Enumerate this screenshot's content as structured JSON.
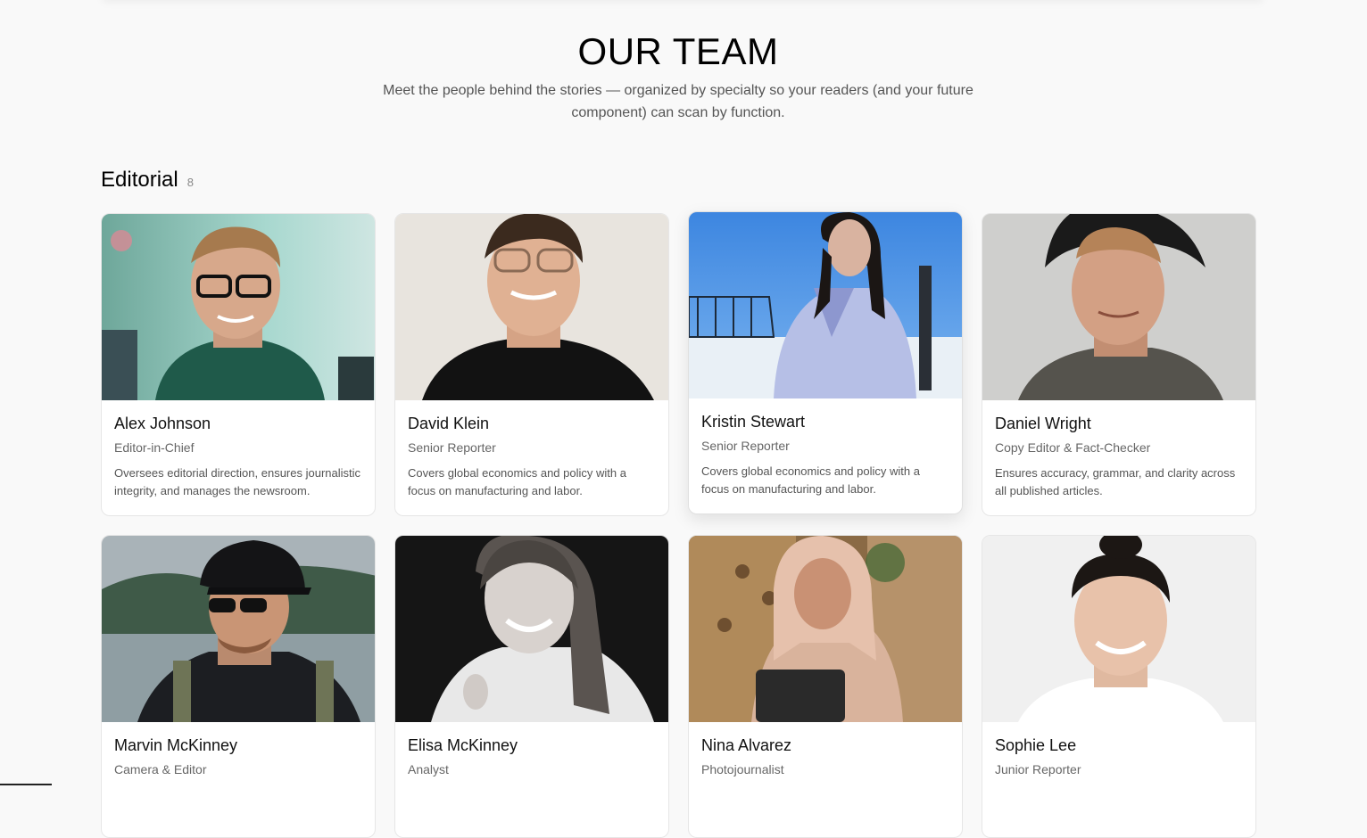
{
  "hero": {
    "title": "OUR TEAM",
    "subtitle": "Meet the people behind the stories — organized by specialty so your readers (and your future component) can scan by function."
  },
  "section": {
    "title": "Editorial",
    "count": "8"
  },
  "members": [
    {
      "name": "Alex Johnson",
      "role": "Editor-in-Chief",
      "desc": "Oversees editorial direction, ensures journalistic integrity, and manages the newsroom."
    },
    {
      "name": "David Klein",
      "role": "Senior Reporter",
      "desc": "Covers global economics and policy with a focus on manufacturing and labor."
    },
    {
      "name": "Kristin Stewart",
      "role": "Senior Reporter",
      "desc": "Covers global economics and policy with a focus on manufacturing and labor."
    },
    {
      "name": "Daniel Wright",
      "role": "Copy Editor & Fact-Checker",
      "desc": "Ensures accuracy, grammar, and clarity across all published articles."
    },
    {
      "name": "Marvin McKinney",
      "role": "Camera & Editor",
      "desc": ""
    },
    {
      "name": "Elisa McKinney",
      "role": "Analyst",
      "desc": ""
    },
    {
      "name": "Nina Alvarez",
      "role": "Photojournalist",
      "desc": ""
    },
    {
      "name": "Sophie Lee",
      "role": "Junior Reporter",
      "desc": ""
    }
  ],
  "colors": {
    "background": "#f9f9f9",
    "card": "#ffffff",
    "name": "#111111",
    "role": "#666666",
    "desc": "#555555"
  }
}
